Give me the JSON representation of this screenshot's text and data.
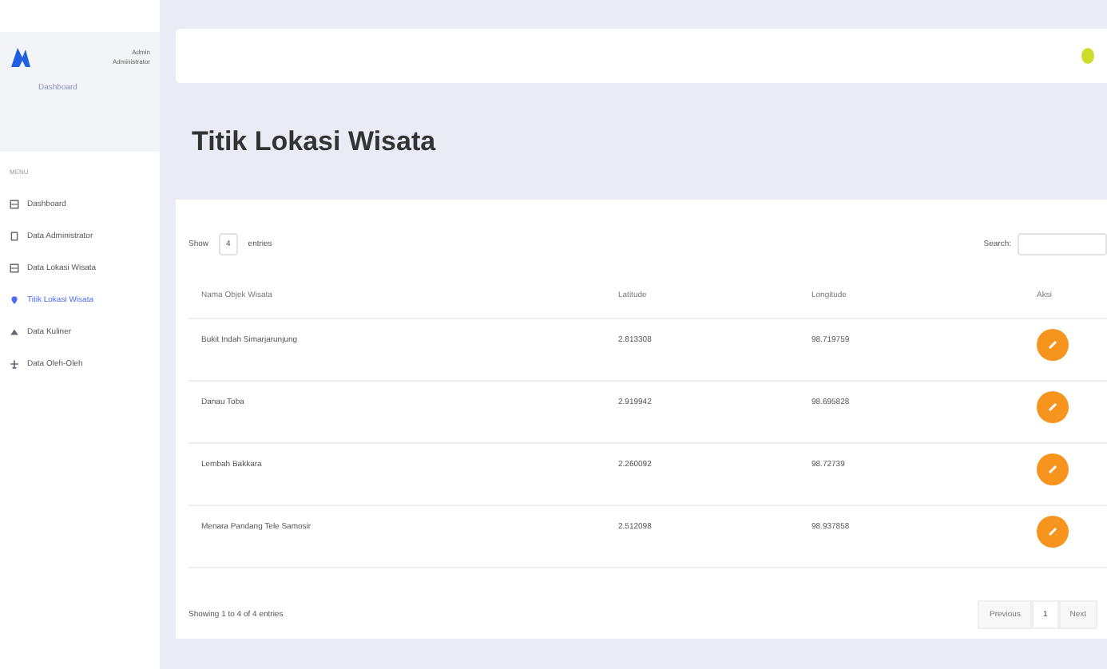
{
  "sidebar": {
    "user_name": "Admin",
    "user_role": "Administrator",
    "subtitle": "Dashboard",
    "menu_label": "MENU",
    "items": [
      {
        "label": "Dashboard",
        "kind": "grid",
        "selected": false
      },
      {
        "label": "Data Administrator",
        "kind": "doc",
        "selected": false
      },
      {
        "label": "Data Lokasi Wisata",
        "kind": "grid",
        "selected": false
      },
      {
        "label": "Titik Lokasi Wisata",
        "kind": "pin",
        "selected": true
      },
      {
        "label": "Data Kuliner",
        "kind": "food",
        "selected": false
      },
      {
        "label": "Data Oleh-Oleh",
        "kind": "gift",
        "selected": false
      }
    ]
  },
  "page_title": "Titik Lokasi Wisata",
  "table_controls": {
    "show_label": "Show",
    "entries_value": "4",
    "entries_label": "entries",
    "search_label": "Search:"
  },
  "table": {
    "columns": [
      "Nama Objek Wisata",
      "Latitude",
      "Longitude",
      "Aksi"
    ],
    "rows": [
      [
        "Bukit Indah Simarjarunjung",
        "2.813308",
        "98.719759"
      ],
      [
        "Danau Toba",
        "2.919942",
        "98.695828"
      ],
      [
        "Lembah Bakkara",
        "2.260092",
        "98.72739"
      ],
      [
        "Menara Pandang Tele Samosir",
        "2.512098",
        "98.937858"
      ]
    ]
  },
  "footer": {
    "info": "Showing 1 to 4 of 4 entries",
    "pages": [
      {
        "label": "Previous",
        "selected": false
      },
      {
        "label": "1",
        "selected": true
      },
      {
        "label": "Next",
        "selected": false
      }
    ]
  }
}
